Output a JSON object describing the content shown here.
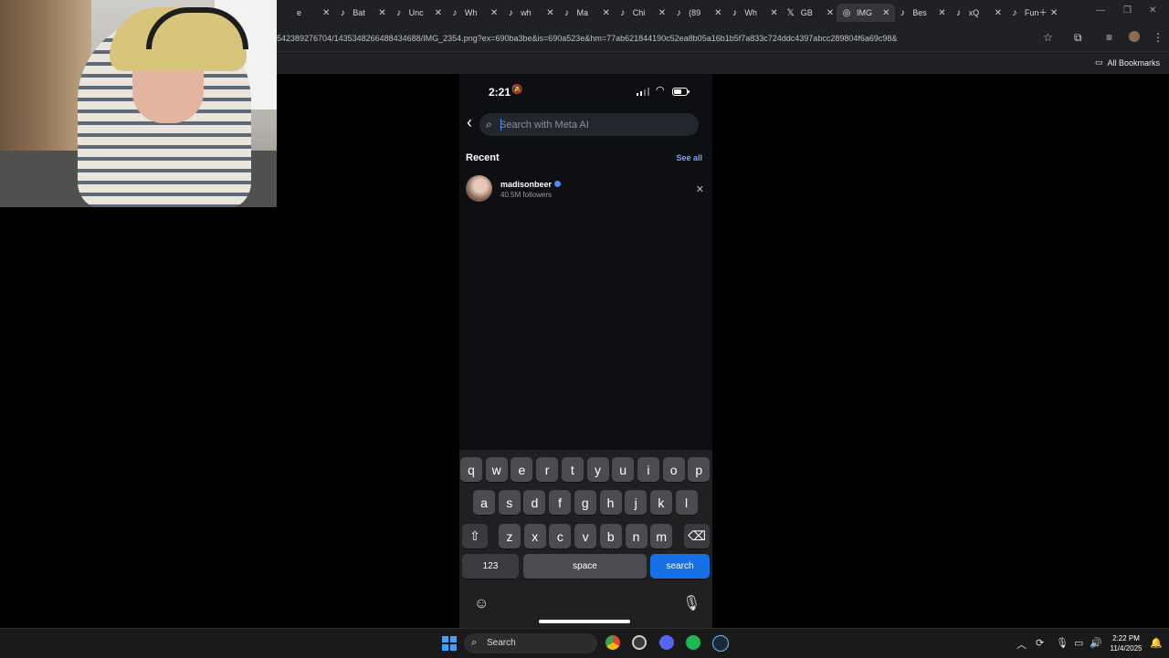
{
  "browser": {
    "tabs": [
      {
        "icon": "",
        "label": "e"
      },
      {
        "icon": "tiktok",
        "label": "Bat"
      },
      {
        "icon": "tiktok",
        "label": "Unc"
      },
      {
        "icon": "tiktok",
        "label": "Wh"
      },
      {
        "icon": "tiktok",
        "label": "wh"
      },
      {
        "icon": "tiktok",
        "label": "Ma"
      },
      {
        "icon": "tiktok",
        "label": "Chi"
      },
      {
        "icon": "tiktok",
        "label": "(89"
      },
      {
        "icon": "tiktok",
        "label": "Wh"
      },
      {
        "icon": "x",
        "label": "GB"
      },
      {
        "icon": "globe",
        "label": "IMG",
        "active": true
      },
      {
        "icon": "tiktok",
        "label": "Bes"
      },
      {
        "icon": "tiktok",
        "label": "xQ"
      },
      {
        "icon": "tiktok",
        "label": "Fun"
      }
    ],
    "url": "542389276704/1435348266488434688/IMG_2354.png?ex=690ba3be&is=690a523e&hm=77ab621844190c52ea8b05a16b1b5f7a833c724ddc4397abcc289804f6a69c98&",
    "bookmarks_label": "All Bookmarks"
  },
  "phone": {
    "status": {
      "time": "2:21",
      "battery_level": 0.65
    },
    "search": {
      "placeholder": "Search with Meta AI",
      "value": ""
    },
    "recent": {
      "title": "Recent",
      "see_all": "See all",
      "items": [
        {
          "name": "madisonbeer",
          "followers": "40.5M followers",
          "verified": true
        }
      ]
    },
    "keyboard": {
      "row1": [
        "q",
        "w",
        "e",
        "r",
        "t",
        "y",
        "u",
        "i",
        "o",
        "p"
      ],
      "row2": [
        "a",
        "s",
        "d",
        "f",
        "g",
        "h",
        "j",
        "k",
        "l"
      ],
      "row3": [
        "z",
        "x",
        "c",
        "v",
        "b",
        "n",
        "m"
      ],
      "numbers_key": "123",
      "space_key": "space",
      "action_key": "search"
    }
  },
  "taskbar": {
    "search_label": "Search",
    "time": "2:22 PM",
    "date": "11/4/2025"
  }
}
